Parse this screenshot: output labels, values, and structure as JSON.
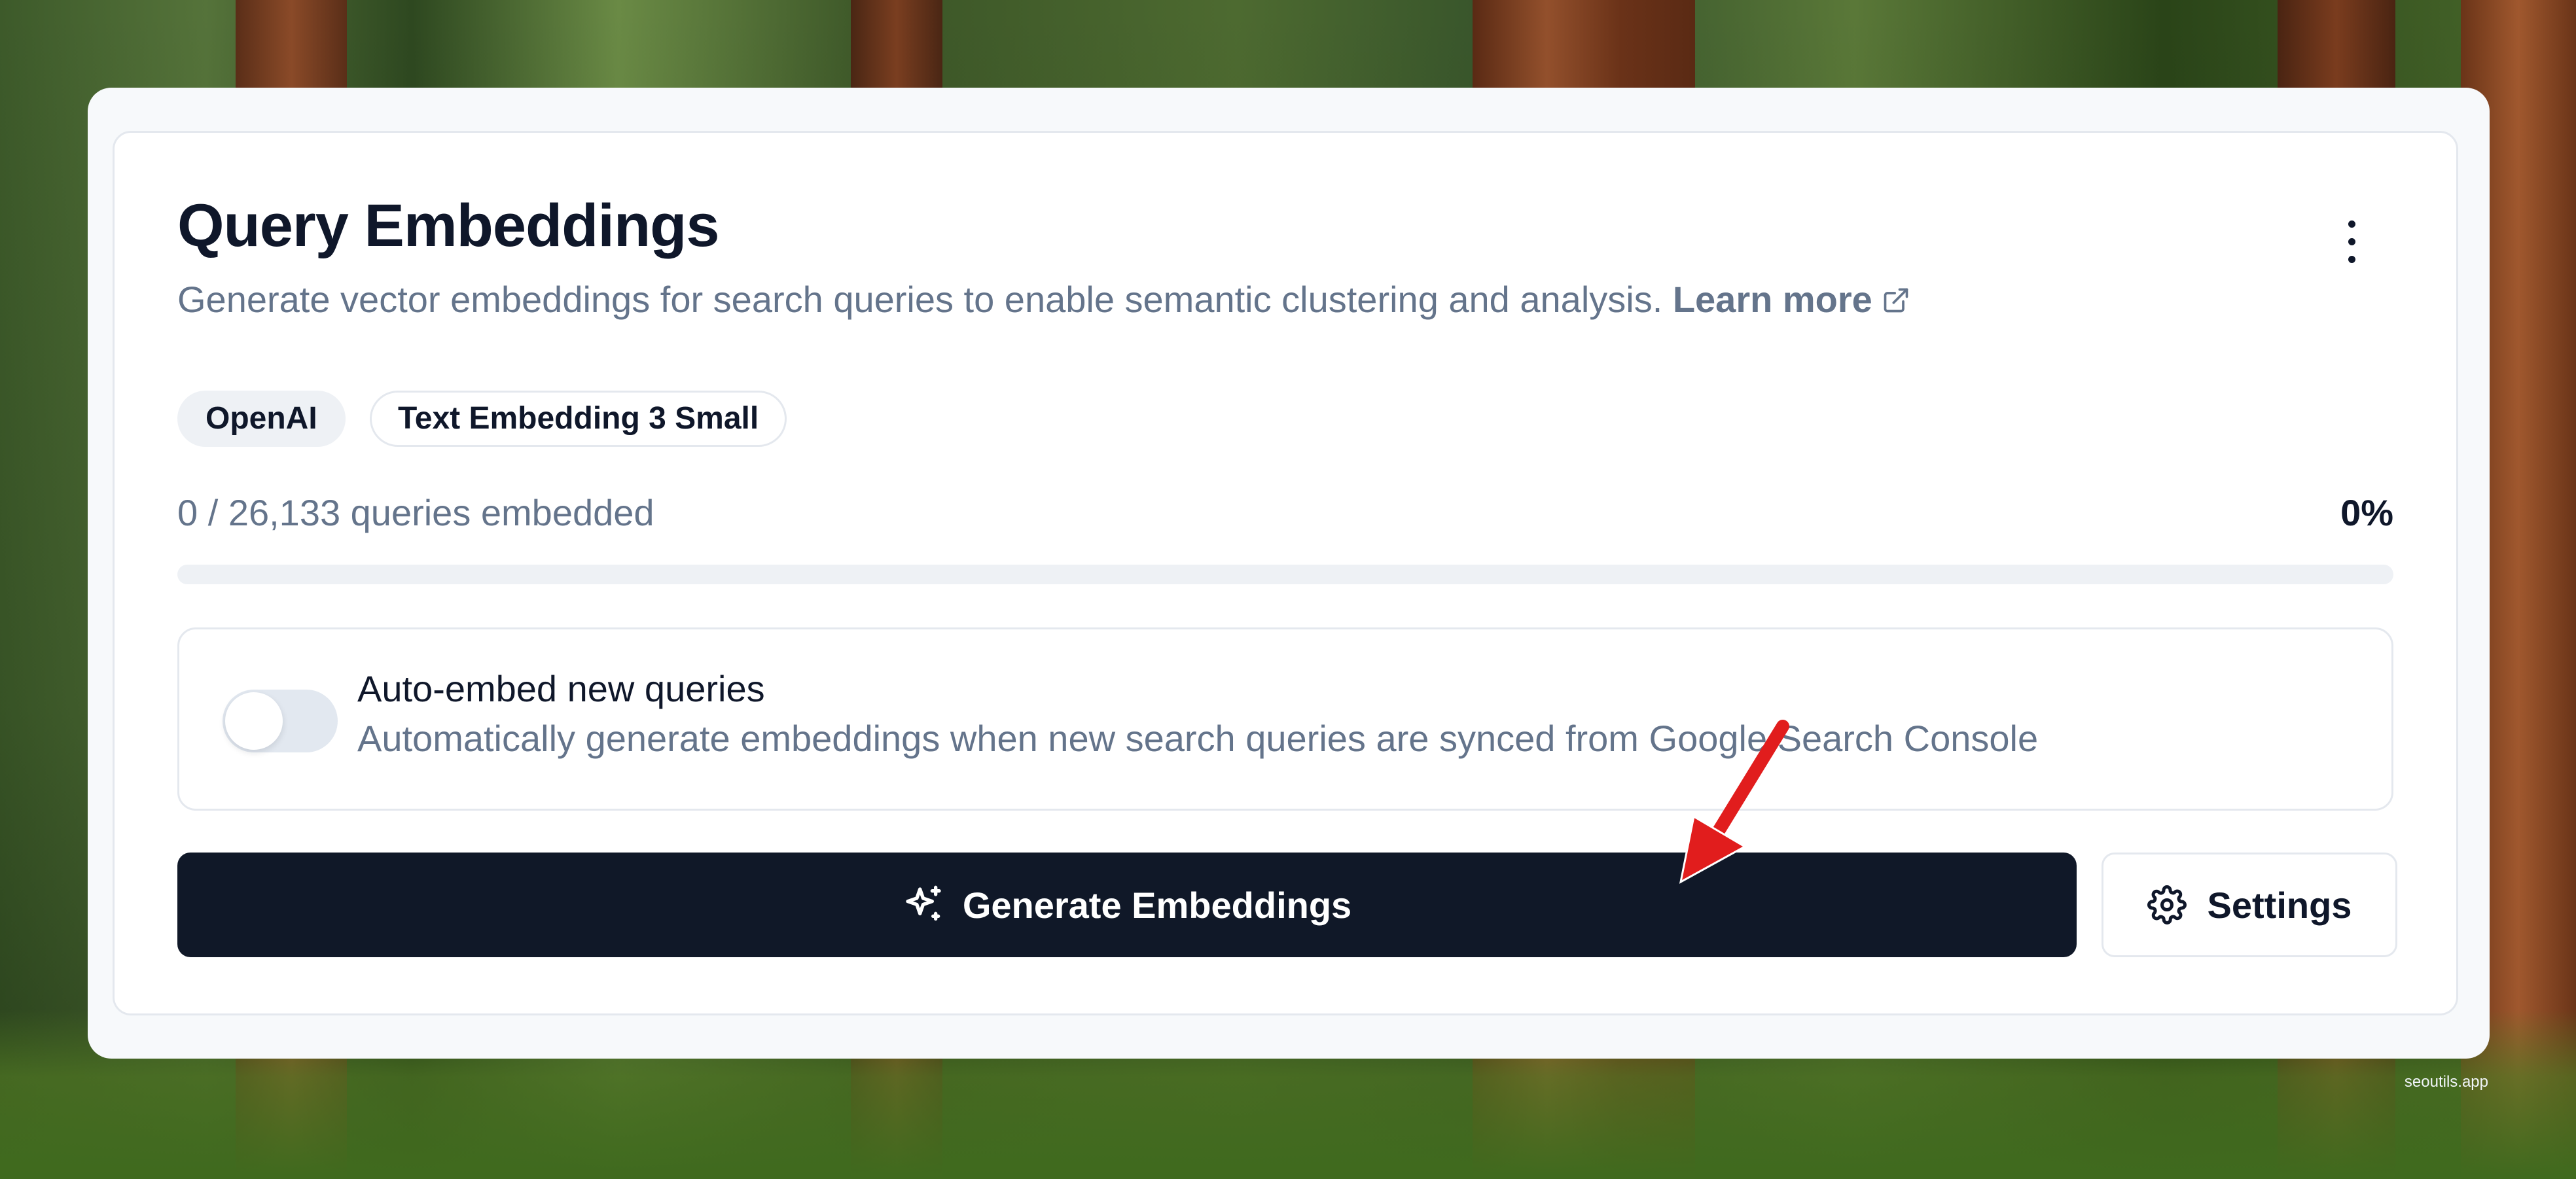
{
  "card": {
    "title": "Query Embeddings",
    "description": "Generate vector embeddings for search queries to enable semantic clustering and analysis.",
    "learn_more": "Learn more"
  },
  "badges": {
    "provider": "OpenAI",
    "model": "Text Embedding 3 Small"
  },
  "progress": {
    "label": "0 / 26,133 queries embedded",
    "percent_label": "0%",
    "fraction": 0
  },
  "auto_embed": {
    "title": "Auto-embed new queries",
    "description": "Automatically generate embeddings when new search queries are synced from Google Search Console",
    "enabled": false
  },
  "actions": {
    "generate_label": "Generate Embeddings",
    "settings_label": "Settings"
  },
  "annotation": {
    "arrow_color": "#e11d1d"
  },
  "watermark": "seoutils.app",
  "colors": {
    "primary": "#101828",
    "muted_text": "#64748b",
    "border": "#e4e8ee"
  }
}
